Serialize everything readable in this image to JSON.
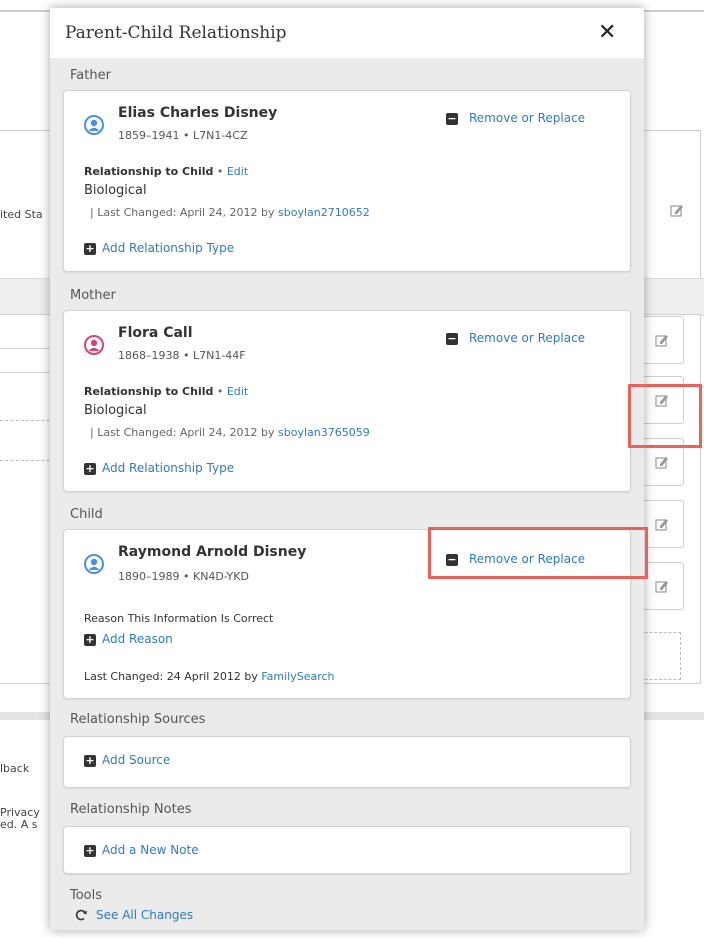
{
  "background": {
    "text_fragment_1": "ited Sta",
    "text_fragment_2": "lback",
    "text_fragment_3": "Privacy",
    "text_fragment_4": "ed. A s"
  },
  "modal": {
    "title": "Parent-Child Relationship",
    "close_label": "✕"
  },
  "father": {
    "section_label": "Father",
    "name": "Elias Charles Disney",
    "years": "1859–1941",
    "id": "L7N1-4CZ",
    "remove_label": "Remove or Replace",
    "relationship_label": "Relationship to Child",
    "edit_label": "Edit",
    "relationship_type": "Biological",
    "last_changed_text": "| Last Changed: April 24, 2012 by",
    "changed_by": "sboylan2710652",
    "add_type_label": "Add Relationship Type"
  },
  "mother": {
    "section_label": "Mother",
    "name": "Flora Call",
    "years": "1868–1938",
    "id": "L7N1-44F",
    "remove_label": "Remove or Replace",
    "relationship_label": "Relationship to Child",
    "edit_label": "Edit",
    "relationship_type": "Biological",
    "last_changed_text": "| Last Changed: April 24, 2012 by",
    "changed_by": "sboylan3765059",
    "add_type_label": "Add Relationship Type"
  },
  "child": {
    "section_label": "Child",
    "name": "Raymond Arnold Disney",
    "years": "1890–1989",
    "id": "KN4D-YKD",
    "remove_label": "Remove or Replace",
    "reason_label": "Reason This Information Is Correct",
    "add_reason_label": "Add Reason",
    "last_changed_text": "Last Changed: 24 April 2012 by",
    "changed_by": "FamilySearch"
  },
  "sources": {
    "section_label": "Relationship Sources",
    "add_label": "Add Source"
  },
  "notes": {
    "section_label": "Relationship Notes",
    "add_label": "Add a New Note"
  },
  "tools": {
    "section_label": "Tools",
    "see_all_label": "See All Changes"
  },
  "icons": {
    "male": "person-male-icon",
    "female": "person-female-icon",
    "minus": "minus-icon",
    "plus": "plus-icon",
    "edit": "edit-icon",
    "refresh": "refresh-icon",
    "close": "close-icon"
  },
  "colors": {
    "male": "#4a90e2",
    "female": "#d6457a",
    "link": "#2f7ac0",
    "highlight": "#e8625a",
    "modal_bg": "#ebebeb"
  }
}
